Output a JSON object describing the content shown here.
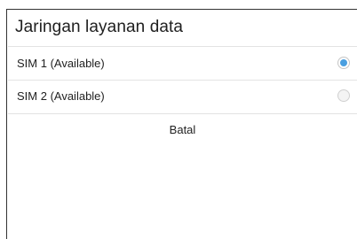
{
  "dialog": {
    "title": "Jaringan layanan data",
    "options": [
      {
        "label": "SIM 1 (Available)",
        "selected": true
      },
      {
        "label": "SIM 2 (Available)",
        "selected": false
      }
    ],
    "cancel_label": "Batal"
  },
  "colors": {
    "accent": "#4a9fe0",
    "divider": "#e3e3e3",
    "frame_border": "#333333"
  }
}
